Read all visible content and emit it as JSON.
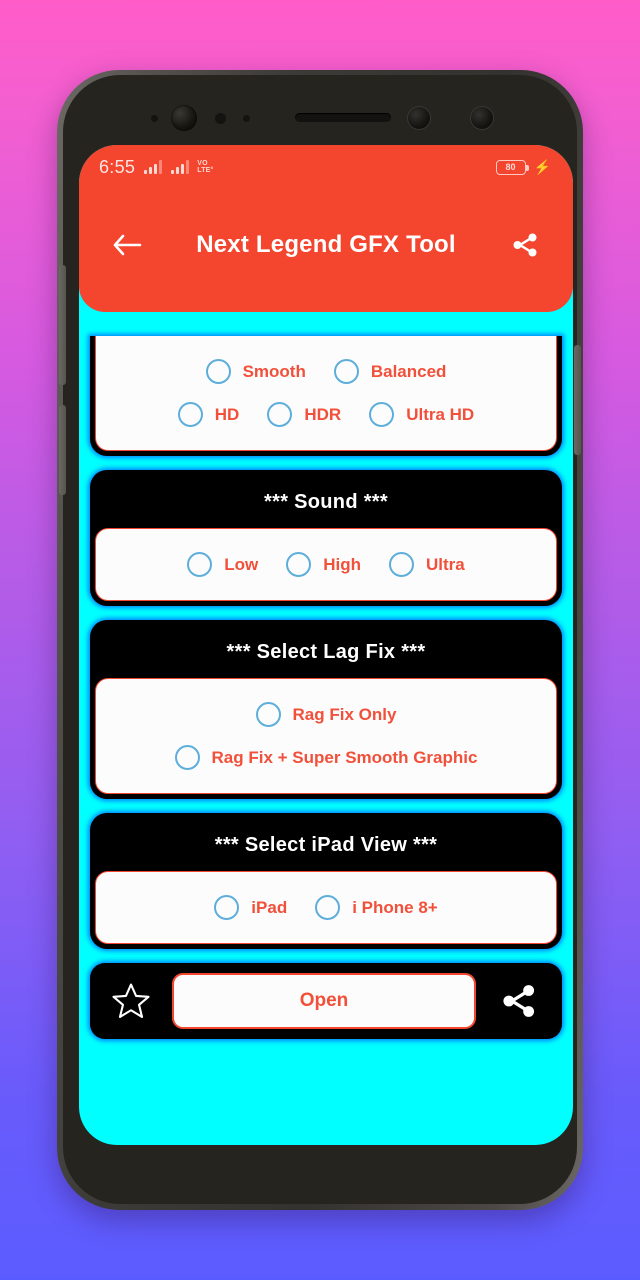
{
  "statusbar": {
    "time": "6:55",
    "network_label": "VO LTE",
    "volte_line1": "VO",
    "volte_line2": "LTE°",
    "battery_level": "80",
    "charging_icon": "bolt-icon"
  },
  "appbar": {
    "title": "Next Legend GFX Tool",
    "back_icon": "back-arrow-icon",
    "share_icon": "share-icon",
    "background_color": "#f4452f"
  },
  "theme": {
    "screen_background": "#00ffff",
    "card_background": "#000000",
    "panel_background": "#fcfcfc",
    "accent_red": "#f1503a",
    "radio_blue": "#5eaedc",
    "glow_blue": "#006eff"
  },
  "cards": [
    {
      "title": "",
      "clipped": true,
      "rows": [
        {
          "options": [
            {
              "label": "Smooth",
              "selected": false
            },
            {
              "label": "Balanced",
              "selected": false
            }
          ]
        },
        {
          "options": [
            {
              "label": "HD",
              "selected": false
            },
            {
              "label": "HDR",
              "selected": false
            },
            {
              "label": "Ultra HD",
              "selected": false
            }
          ]
        }
      ]
    },
    {
      "title": "*** Sound ***",
      "clipped": false,
      "rows": [
        {
          "options": [
            {
              "label": "Low",
              "selected": false
            },
            {
              "label": "High",
              "selected": false
            },
            {
              "label": "Ultra",
              "selected": false
            }
          ]
        }
      ]
    },
    {
      "title": "*** Select Lag Fix ***",
      "clipped": false,
      "rows": [
        {
          "options": [
            {
              "label": "Rag Fix Only",
              "selected": false
            }
          ]
        },
        {
          "options": [
            {
              "label": "Rag Fix + Super Smooth Graphic",
              "selected": false
            }
          ]
        }
      ]
    },
    {
      "title": "*** Select iPad View ***",
      "clipped": false,
      "rows": [
        {
          "options": [
            {
              "label": "iPad",
              "selected": false
            },
            {
              "label": "i Phone 8+",
              "selected": false
            }
          ]
        }
      ]
    }
  ],
  "actionbar": {
    "star_icon": "star-outline-icon",
    "open_label": "Open",
    "share_icon": "share-icon"
  }
}
